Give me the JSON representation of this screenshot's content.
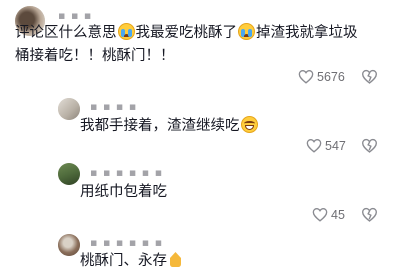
{
  "comments": [
    {
      "username": "▪ ▪ ▪",
      "text_parts": [
        "评论区什么意思",
        "我最爱吃桃酥了",
        "掉渣我就拿垃圾"
      ],
      "text_line2": "桶接着吃！！桃酥门！！",
      "likes": "5676",
      "emojis": [
        "loudly-crying-face",
        "loudly-crying-face"
      ]
    },
    {
      "username": "▪ ▪ ▪ ▪",
      "text": "我都手接着，渣渣继续吃",
      "likes": "547",
      "emojis": [
        "laughing-face"
      ]
    },
    {
      "username": "▪ ▪ ▪ ▪ ▪ ▪",
      "text": "用纸巾包着吃",
      "likes": "45",
      "emojis": []
    },
    {
      "username": "▪ ▪ ▪ ▪ ▪ ▪",
      "text": "桃酥门、永存",
      "emojis": [
        "folded-hands"
      ]
    }
  ],
  "colors": {
    "text": "#161823",
    "secondary": "#a3a3a8",
    "icon": "#8a8b91"
  }
}
